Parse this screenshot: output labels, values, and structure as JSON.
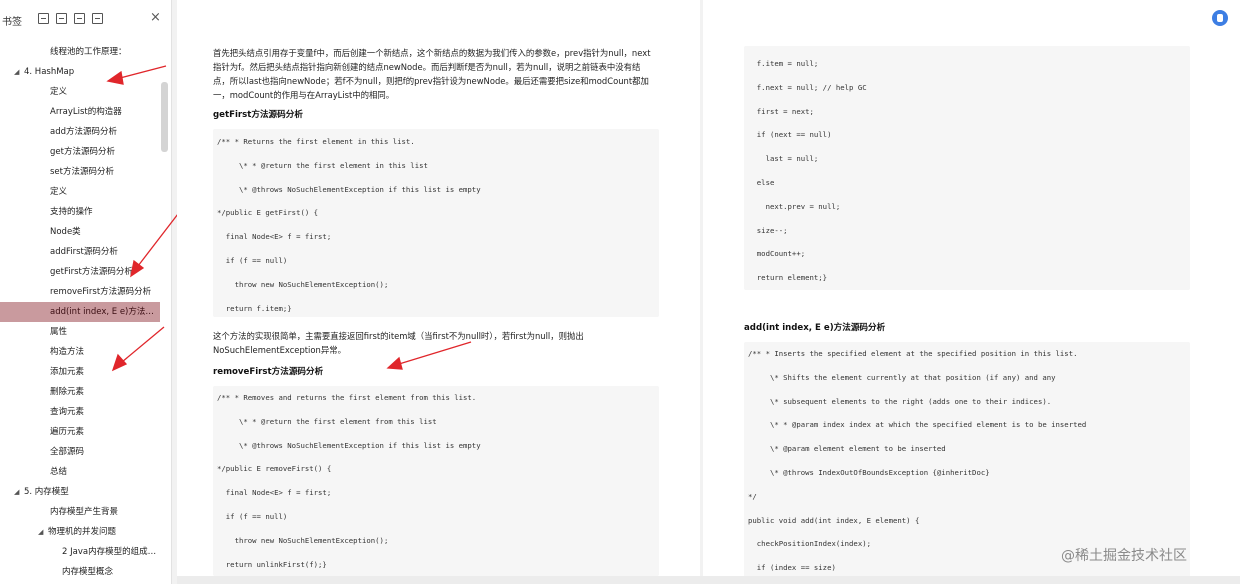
{
  "sidebar": {
    "title": "书签",
    "close_icon": "×",
    "items": [
      {
        "label": "线程池的工作原理：",
        "indent": 2,
        "toggle": ""
      },
      {
        "label": "4. HashMap",
        "indent": 1,
        "toggle": "◢"
      },
      {
        "label": "定义",
        "indent": 2,
        "toggle": ""
      },
      {
        "label": "ArrayList的构造器",
        "indent": 2,
        "toggle": ""
      },
      {
        "label": "add方法源码分析",
        "indent": 2,
        "toggle": ""
      },
      {
        "label": "get方法源码分析",
        "indent": 2,
        "toggle": ""
      },
      {
        "label": "set方法源码分析",
        "indent": 2,
        "toggle": ""
      },
      {
        "label": "定义",
        "indent": 2,
        "toggle": ""
      },
      {
        "label": "支持的操作",
        "indent": 2,
        "toggle": ""
      },
      {
        "label": "Node类",
        "indent": 2,
        "toggle": ""
      },
      {
        "label": "addFirst源码分析",
        "indent": 2,
        "toggle": ""
      },
      {
        "label": "getFirst方法源码分析",
        "indent": 2,
        "toggle": ""
      },
      {
        "label": "removeFirst方法源码分析",
        "indent": 2,
        "toggle": ""
      },
      {
        "label": "add(int index, E e)方法源码分析",
        "indent": 2,
        "toggle": "",
        "active": true
      },
      {
        "label": "属性",
        "indent": 2,
        "toggle": ""
      },
      {
        "label": "构造方法",
        "indent": 2,
        "toggle": ""
      },
      {
        "label": "添加元素",
        "indent": 2,
        "toggle": ""
      },
      {
        "label": "删除元素",
        "indent": 2,
        "toggle": ""
      },
      {
        "label": "查询元素",
        "indent": 2,
        "toggle": ""
      },
      {
        "label": "遍历元素",
        "indent": 2,
        "toggle": ""
      },
      {
        "label": "全部源码",
        "indent": 2,
        "toggle": ""
      },
      {
        "label": "总结",
        "indent": 2,
        "toggle": ""
      },
      {
        "label": "5. 内存模型",
        "indent": 1,
        "toggle": "◢"
      },
      {
        "label": "内存模型产生背景",
        "indent": 2,
        "toggle": ""
      },
      {
        "label": "物理机的并发问题",
        "indent": 2,
        "toggle": "◢"
      },
      {
        "label": "2 Java内存模型的组成分析",
        "indent": 3,
        "toggle": ""
      },
      {
        "label": "内存模型概念",
        "indent": 3,
        "toggle": ""
      }
    ]
  },
  "page1": {
    "para1": [
      "首先把头结点引用存于变量f中，而后创建一个新结点，这个新结点的数据为我们传入的参数e，prev指针为null，next",
      "指针为f。然后把头结点指针指向新创建的结点newNode。而后判断f是否为null，若为null，说明之前链表中没有结",
      "点，所以last也指向newNode；若f不为null，则把f的prev指针设为newNode。最后还需要把size和modCount都加",
      "一，modCount的作用与在ArrayList中的相同。"
    ],
    "heading1": "getFirst方法源码分析",
    "code1": [
      "/** * Returns the first element in this list.",
      "",
      "     \\* * @return the first element in this list",
      "",
      "     \\* @throws NoSuchElementException if this list is empty",
      "",
      "*/public E getFirst() {",
      "",
      "  final Node<E> f = first;",
      "",
      "  if (f == null)",
      "",
      "    throw new NoSuchElementException();",
      "",
      "  return f.item;}"
    ],
    "para2": [
      "这个方法的实现很简单，主需要直接返回first的item域（当first不为null时），若first为null，则抛出",
      "NoSuchElementException异常。"
    ],
    "heading2": "removeFirst方法源码分析",
    "code2": [
      "/** * Removes and returns the first element from this list.",
      "",
      "     \\* * @return the first element from this list",
      "",
      "     \\* @throws NoSuchElementException if this list is empty",
      "",
      "*/public E removeFirst() {",
      "",
      "  final Node<E> f = first;",
      "",
      "  if (f == null)",
      "",
      "    throw new NoSuchElementException();",
      "",
      "  return unlinkFirst(f);}"
    ]
  },
  "page2": {
    "code1": [
      "  f.item = null;",
      "",
      "  f.next = null; // help GC",
      "",
      "  first = next;",
      "",
      "  if (next == null)",
      "",
      "    last = null;",
      "",
      "  else",
      "",
      "    next.prev = null;",
      "",
      "  size--;",
      "",
      "  modCount++;",
      "",
      "  return element;}"
    ],
    "heading": "add(int index, E e)方法源码分析",
    "code2": [
      "/** * Inserts the specified element at the specified position in this list.",
      "",
      "     \\* Shifts the element currently at that position (if any) and any",
      "",
      "     \\* subsequent elements to the right (adds one to their indices).",
      "",
      "     \\* * @param index index at which the specified element is to be inserted",
      "",
      "     \\* @param element element to be inserted",
      "",
      "     \\* @throws IndexOutOfBoundsException {@inheritDoc}",
      "",
      "*/",
      "",
      "public void add(int index, E element) {",
      "",
      "  checkPositionIndex(index);",
      "",
      "  if (index == size)"
    ]
  },
  "watermark": "@稀土掘金技术社区",
  "colors": {
    "active_item": "#c99a9e",
    "arrow": "#e0262b",
    "avatar": "#3d7ee3",
    "code_bg": "#f6f6f6"
  }
}
